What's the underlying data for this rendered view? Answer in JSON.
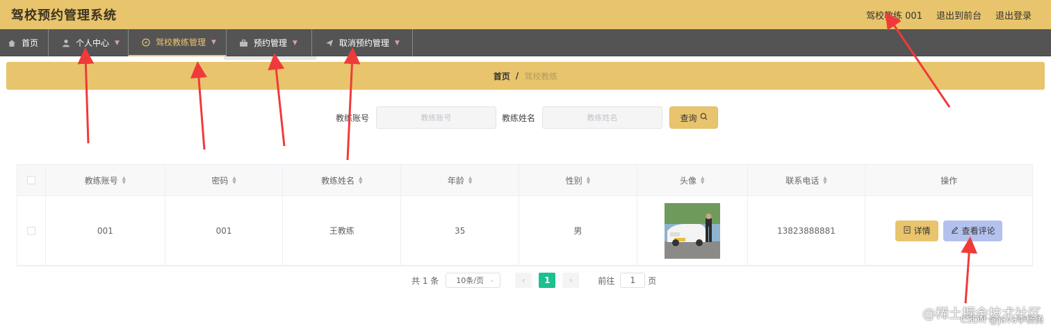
{
  "app": {
    "title": "驾校预约管理系统"
  },
  "top_right": {
    "user": "驾校教练 001",
    "back_front": "退出到前台",
    "logout": "退出登录"
  },
  "nav": [
    {
      "label": "首页",
      "icon": "home-icon",
      "has_caret": false
    },
    {
      "label": "个人中心",
      "icon": "user-icon",
      "has_caret": true
    },
    {
      "label": "驾校教练管理",
      "icon": "compass-icon",
      "has_caret": true,
      "active": true
    },
    {
      "label": "预约管理",
      "icon": "briefcase-icon",
      "has_caret": true
    },
    {
      "label": "取消预约管理",
      "icon": "send-icon",
      "has_caret": true
    }
  ],
  "breadcrumb": {
    "home": "首页",
    "separator": "/",
    "current": "驾校教练"
  },
  "search": {
    "account_label": "教练账号",
    "account_placeholder": "教练账号",
    "name_label": "教练姓名",
    "name_placeholder": "教练姓名",
    "button": "查询"
  },
  "table": {
    "headers": [
      "教练账号",
      "密码",
      "教练姓名",
      "年龄",
      "性别",
      "头像",
      "联系电话",
      "操作"
    ],
    "rows": [
      {
        "account": "001",
        "password": "001",
        "name": "王教练",
        "age": "35",
        "gender": "男",
        "phone": "13823888881"
      }
    ],
    "actions": {
      "detail": "详情",
      "review": "查看评论"
    }
  },
  "pagination": {
    "total": "共 1 条",
    "page_size": "10条/页",
    "current_page": "1",
    "goto_label": "前往",
    "goto_value": "1",
    "page_suffix": "页"
  },
  "watermark": {
    "line1": "@稀土掘金技术社区",
    "line2": "CSDN @java李杨勇"
  },
  "colors": {
    "topbar": "#e8c46c",
    "navbar": "#545454",
    "pager_active": "#1ec08f",
    "review_button": "#b3c1ed",
    "annotation_arrow": "#f03a3a"
  }
}
